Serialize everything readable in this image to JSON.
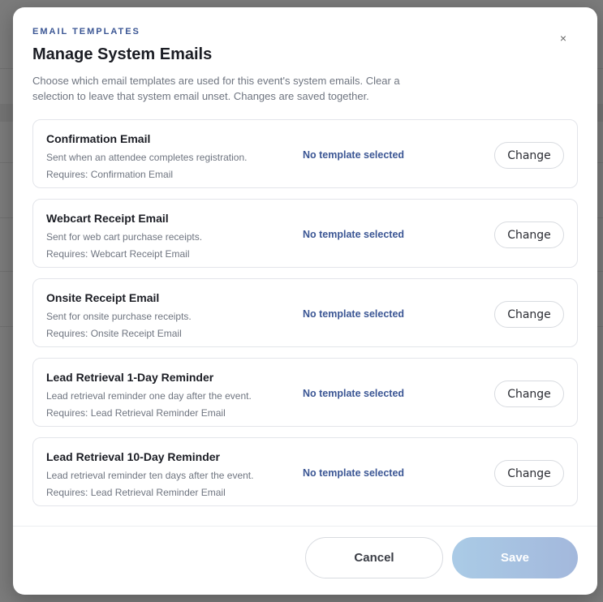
{
  "modal": {
    "eyebrow": "EMAIL TEMPLATES",
    "title": "Manage System Emails",
    "description": "Choose which email templates are used for this event's system emails. Clear a selection to leave that system email unset. Changes are saved together.",
    "close_icon": "close-icon",
    "close_glyph": "×"
  },
  "emails": [
    {
      "name": "Confirmation Email",
      "description": "Sent when an attendee completes registration.",
      "requires": "Requires: Confirmation Email",
      "status": "No template selected",
      "action_label": "Change"
    },
    {
      "name": "Webcart Receipt Email",
      "description": "Sent for web cart purchase receipts.",
      "requires": "Requires: Webcart Receipt Email",
      "status": "No template selected",
      "action_label": "Change"
    },
    {
      "name": "Onsite Receipt Email",
      "description": "Sent for onsite purchase receipts.",
      "requires": "Requires: Onsite Receipt Email",
      "status": "No template selected",
      "action_label": "Change"
    },
    {
      "name": "Lead Retrieval 1-Day Reminder",
      "description": "Lead retrieval reminder one day after the event.",
      "requires": "Requires: Lead Retrieval Reminder Email",
      "status": "No template selected",
      "action_label": "Change"
    },
    {
      "name": "Lead Retrieval 10-Day Reminder",
      "description": "Lead retrieval reminder ten days after the event.",
      "requires": "Requires: Lead Retrieval Reminder Email",
      "status": "No template selected",
      "action_label": "Change"
    }
  ],
  "footer": {
    "cancel_label": "Cancel",
    "save_label": "Save",
    "save_disabled": true
  },
  "colors": {
    "accent": "#3b5694",
    "backdrop": "#7b7b7b",
    "save_gradient_start": "#aacbe6",
    "save_gradient_end": "#a3b8dc"
  }
}
